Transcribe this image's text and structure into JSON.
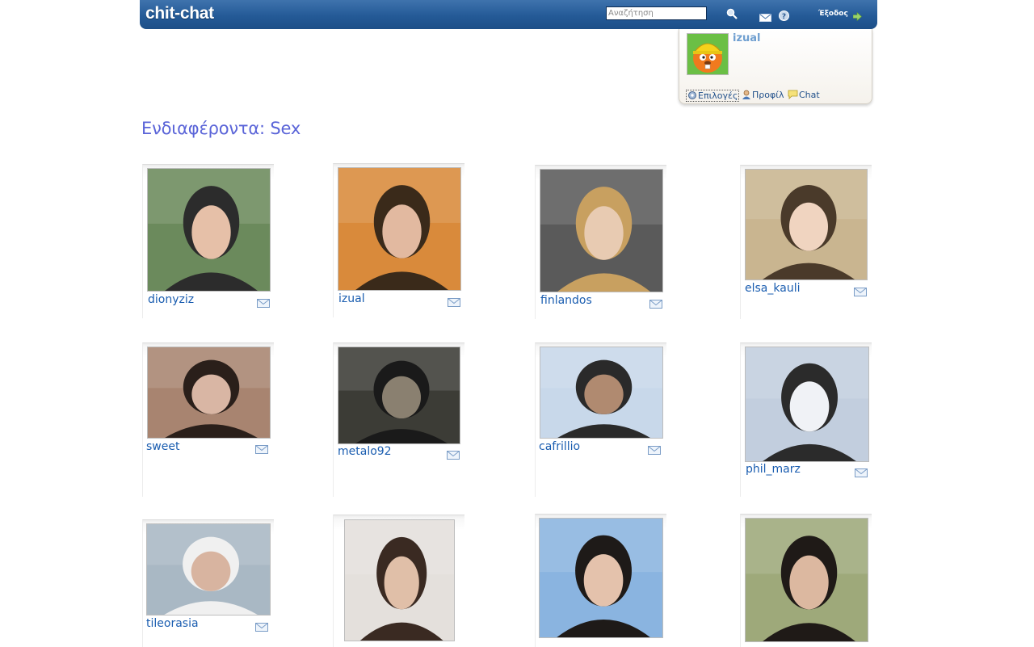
{
  "header": {
    "logo": "chit-chat",
    "search_placeholder": "Αναζήτηση",
    "logout_label": "Έξοδος"
  },
  "user_panel": {
    "username": "izual",
    "links": [
      "Επιλογές",
      "Προφίλ",
      "Chat"
    ]
  },
  "page": {
    "title": "Ενδιαφέροντα: Sex"
  },
  "profiles": [
    {
      "username": "dionyziz",
      "photo_tones": [
        "#6b8a5c",
        "#2c2c2c",
        "#e6c0a8"
      ]
    },
    {
      "username": "izual",
      "photo_tones": [
        "#d98a3b",
        "#3a2a1a",
        "#e2b9a0"
      ]
    },
    {
      "username": "finlandos",
      "photo_tones": [
        "#5a5a5a",
        "#c8a060",
        "#e8cbb2"
      ]
    },
    {
      "username": "elsa_kauli",
      "photo_tones": [
        "#c9b590",
        "#4a3a2a",
        "#f0d4c0"
      ]
    },
    {
      "username": "sweet",
      "photo_tones": [
        "#a88470",
        "#2a1f1a",
        "#d9b6a4"
      ]
    },
    {
      "username": "metalo92",
      "photo_tones": [
        "#3c3c36",
        "#1a1a1a",
        "#8a8070"
      ]
    },
    {
      "username": "cafrillio",
      "photo_tones": [
        "#c8d8ea",
        "#2a2a2a",
        "#b08a70"
      ]
    },
    {
      "username": "phil_marz",
      "photo_tones": [
        "#c2cede",
        "#2b2b2b",
        "#f0f2f6"
      ]
    },
    {
      "username": "tileorasia",
      "photo_tones": [
        "#a9b8c4",
        "#f0f0f0",
        "#d8b4a0"
      ]
    },
    {
      "username": "",
      "photo_tones": [
        "#e4e0dc",
        "#3a2a22",
        "#e0bfa8"
      ]
    },
    {
      "username": "",
      "photo_tones": [
        "#8ab4e0",
        "#1e1a18",
        "#e4c2ac"
      ]
    },
    {
      "username": "",
      "photo_tones": [
        "#9ea97a",
        "#1f1a17",
        "#dcb8a0"
      ]
    }
  ]
}
